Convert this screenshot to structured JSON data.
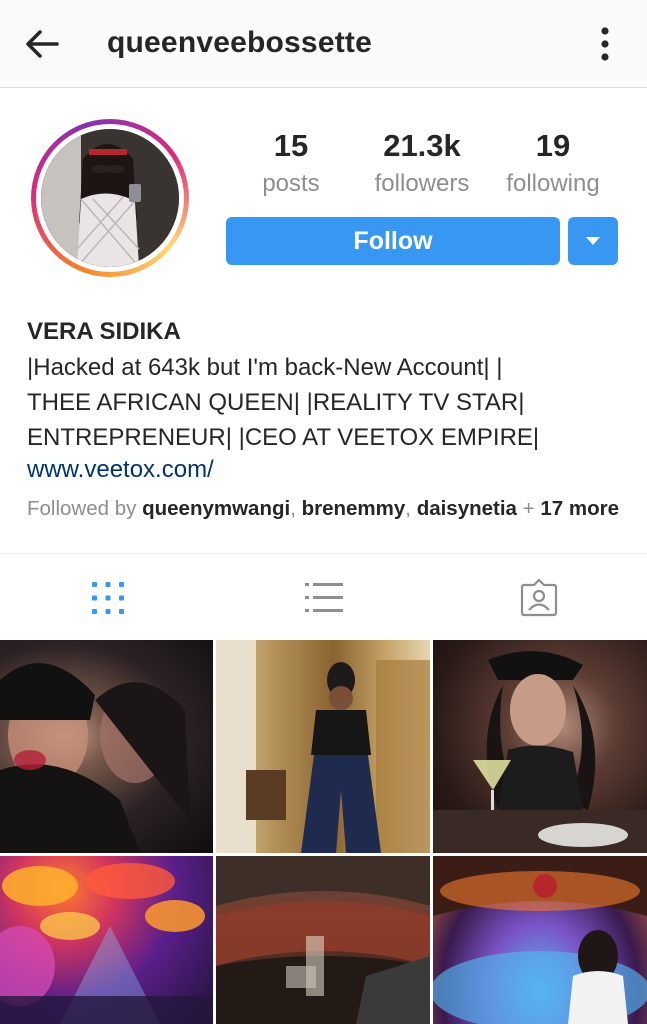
{
  "header": {
    "username": "queenveebossette",
    "back_icon": "arrow-left-icon",
    "more_icon": "vertical-ellipsis-icon"
  },
  "profile": {
    "stats": [
      {
        "value": "15",
        "label": "posts"
      },
      {
        "value": "21.3k",
        "label": "followers"
      },
      {
        "value": "19",
        "label": "following"
      }
    ],
    "follow_label": "Follow",
    "dropdown_icon": "caret-down-icon",
    "accent_color": "#3897f0"
  },
  "bio": {
    "full_name": "VERA SIDIKA",
    "lines": [
      "|Hacked at 643k but I'm back-New Account| |",
      "THEE AFRICAN QUEEN| |REALITY TV STAR|",
      "ENTREPRENEUR| |CEO AT VEETOX EMPIRE|"
    ],
    "website": "www.veetox.com/",
    "followed_by_prefix": "Followed by ",
    "followed_by_users": [
      "queenymwangi",
      "brenemmy",
      "daisynetia"
    ],
    "followed_by_suffix": "17 more"
  },
  "tabs": [
    {
      "icon": "grid-icon",
      "active": true
    },
    {
      "icon": "list-icon",
      "active": false
    },
    {
      "icon": "tagged-icon",
      "active": false
    }
  ]
}
